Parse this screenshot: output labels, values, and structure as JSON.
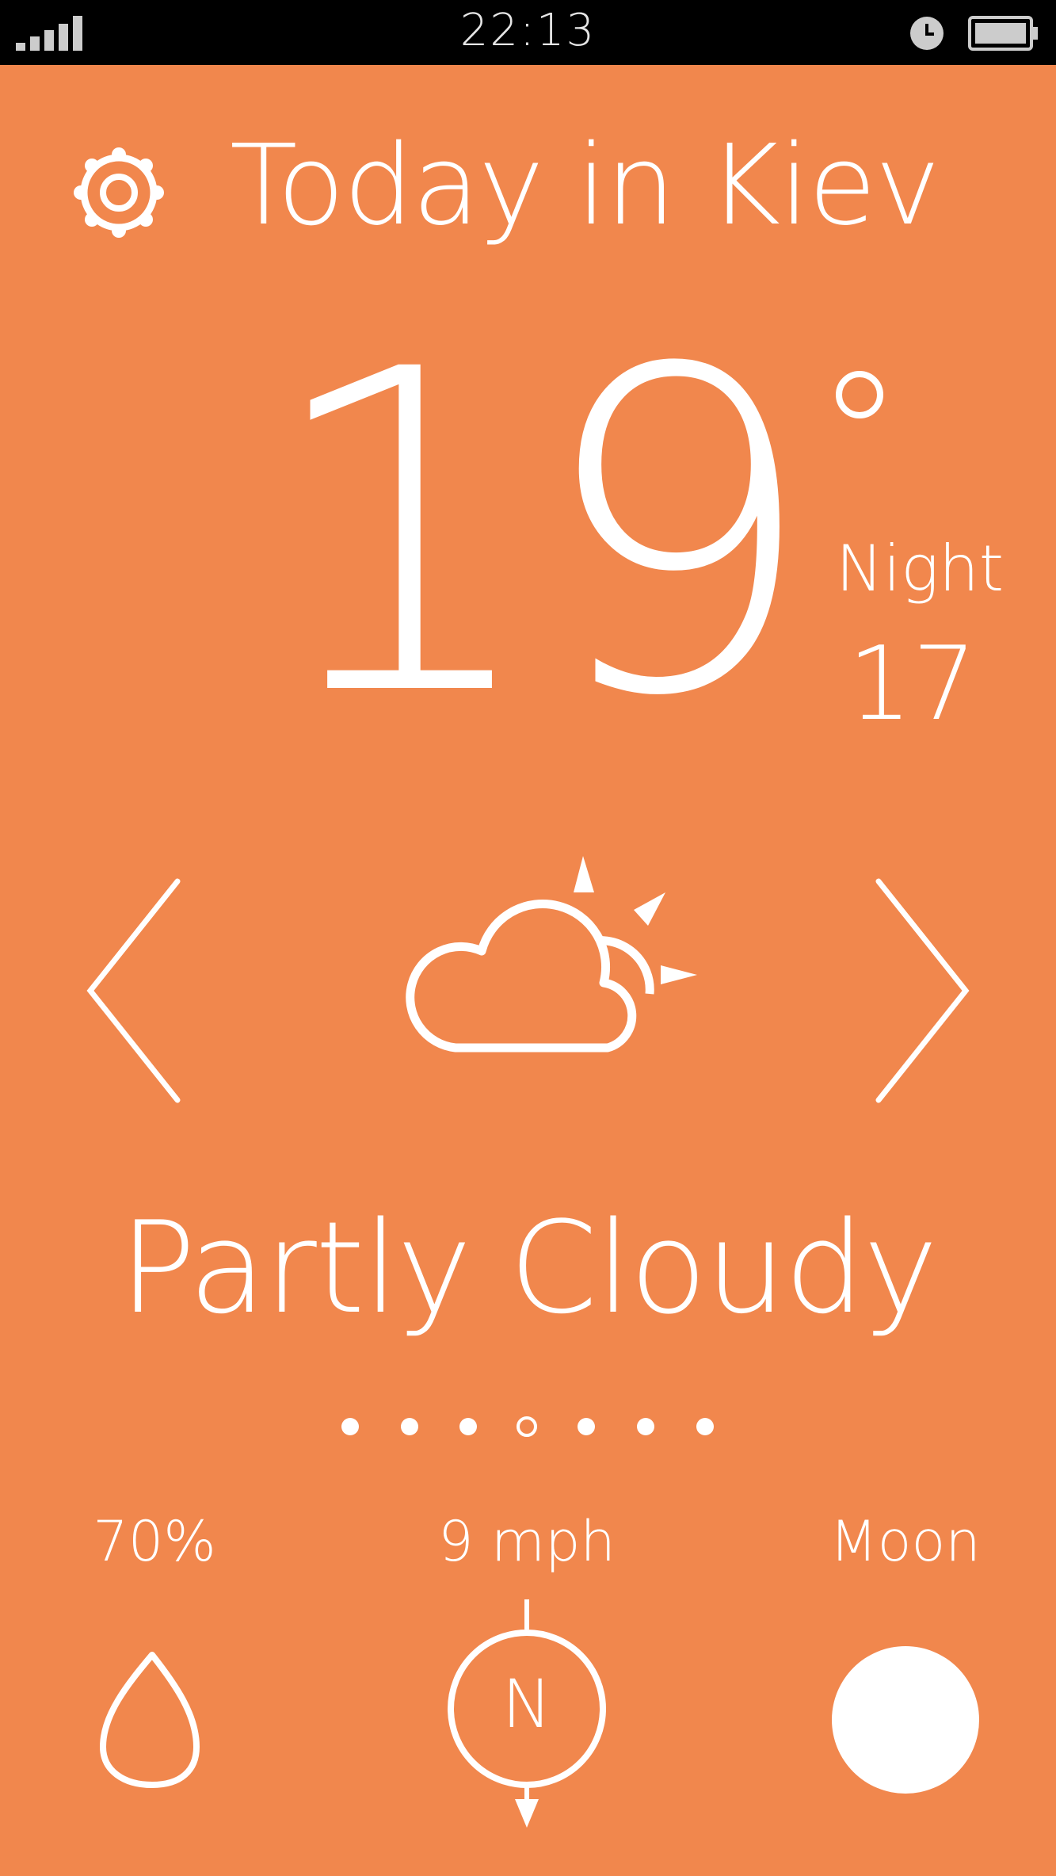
{
  "status_bar": {
    "time": "22:13",
    "signal_icon": "signal-bars-icon",
    "alarm_icon": "alarm-clock-icon",
    "battery_icon": "battery-icon"
  },
  "header": {
    "title": "Today in Kiev",
    "settings_icon": "gear-icon"
  },
  "current": {
    "temperature": "19",
    "degree_symbol": "°",
    "night_label": "Night",
    "night_temperature": "17"
  },
  "forecast": {
    "condition": "Partly Cloudy",
    "condition_icon": "partly-cloudy-icon",
    "prev_icon": "chevron-left-icon",
    "next_icon": "chevron-right-icon"
  },
  "pager": {
    "total": 7,
    "active_index": 3
  },
  "stats": {
    "humidity": {
      "value": "70%",
      "icon": "water-drop-icon"
    },
    "wind": {
      "value": "9 mph",
      "direction": "N",
      "icon": "compass-icon"
    },
    "moon": {
      "value": "Moon",
      "icon": "full-moon-icon"
    }
  },
  "colors": {
    "background": "#F1874D",
    "status_bar": "#000000",
    "foreground": "#FFFFFF"
  }
}
